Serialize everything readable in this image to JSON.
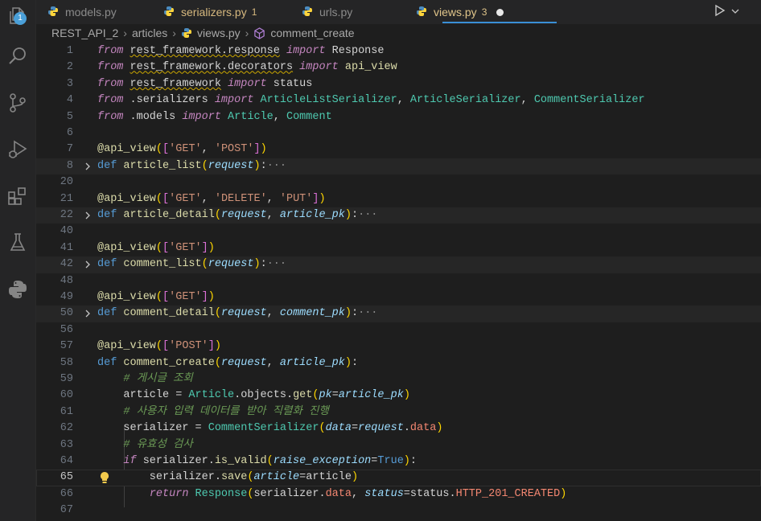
{
  "tabs": [
    {
      "label": "models.py",
      "count": "",
      "state": "normal"
    },
    {
      "label": "serializers.py",
      "count": "1",
      "state": "modified"
    },
    {
      "label": "urls.py",
      "count": "",
      "state": "normal"
    },
    {
      "label": "views.py",
      "count": "3",
      "state": "active"
    }
  ],
  "activity": {
    "scm_badge": "1"
  },
  "breadcrumb": {
    "items": [
      "REST_API_2",
      "articles",
      "views.py",
      "comment_create"
    ]
  },
  "colors": {
    "accent": "#3a8fd6",
    "bulb": "#f2c94c"
  },
  "lines": [
    {
      "n": "1",
      "html": "<span class='ctl'>from</span> <span class='sq'>rest_framework.response</span> <span class='ctl'>import</span> Response"
    },
    {
      "n": "2",
      "html": "<span class='ctl'>from</span> <span class='sq'>rest_framework.decorators</span> <span class='ctl'>import</span> <span class='fn'>api_view</span>"
    },
    {
      "n": "3",
      "html": "<span class='ctl'>from</span> <span class='sq'>rest_framework</span> <span class='ctl'>import</span> status"
    },
    {
      "n": "4",
      "html": "<span class='ctl'>from</span> .serializers <span class='ctl'>import</span> <span class='cls'>ArticleListSerializer</span>, <span class='cls'>ArticleSerializer</span>, <span class='cls'>CommentSerializer</span>"
    },
    {
      "n": "5",
      "html": "<span class='ctl'>from</span> .models <span class='ctl'>import</span> <span class='cls'>Article</span>, <span class='cls'>Comment</span>"
    },
    {
      "n": "6",
      "html": ""
    },
    {
      "n": "7",
      "html": "<span class='dec'>@api_view</span><span class='yb'>(</span><span class='pb'>[</span><span class='str'>'GET'</span>, <span class='str'>'POST'</span><span class='pb'>]</span><span class='yb'>)</span>"
    },
    {
      "n": "8",
      "fold": true,
      "hl": true,
      "html": "<span class='kw'>def</span> <span class='fn'>article_list</span><span class='yb'>(</span><span class='prm'>request</span><span class='yb'>)</span>:<span class='ell'>···</span>"
    },
    {
      "n": "20",
      "html": ""
    },
    {
      "n": "21",
      "html": "<span class='dec'>@api_view</span><span class='yb'>(</span><span class='pb'>[</span><span class='str'>'GET'</span>, <span class='str'>'DELETE'</span>, <span class='str'>'PUT'</span><span class='pb'>]</span><span class='yb'>)</span>"
    },
    {
      "n": "22",
      "fold": true,
      "hl": true,
      "html": "<span class='kw'>def</span> <span class='fn'>article_detail</span><span class='yb'>(</span><span class='prm'>request</span>, <span class='prm'>article_pk</span><span class='yb'>)</span>:<span class='ell'>···</span>"
    },
    {
      "n": "40",
      "html": ""
    },
    {
      "n": "41",
      "html": "<span class='dec'>@api_view</span><span class='yb'>(</span><span class='pb'>[</span><span class='str'>'GET'</span><span class='pb'>]</span><span class='yb'>)</span>"
    },
    {
      "n": "42",
      "fold": true,
      "hl": true,
      "html": "<span class='kw'>def</span> <span class='fn'>comment_list</span><span class='yb'>(</span><span class='prm'>request</span><span class='yb'>)</span>:<span class='ell'>···</span>"
    },
    {
      "n": "48",
      "html": ""
    },
    {
      "n": "49",
      "html": "<span class='dec'>@api_view</span><span class='yb'>(</span><span class='pb'>[</span><span class='str'>'GET'</span><span class='pb'>]</span><span class='yb'>)</span>"
    },
    {
      "n": "50",
      "fold": true,
      "hl": true,
      "html": "<span class='kw'>def</span> <span class='fn'>comment_detail</span><span class='yb'>(</span><span class='prm'>request</span>, <span class='prm'>comment_pk</span><span class='yb'>)</span>:<span class='ell'>···</span>"
    },
    {
      "n": "56",
      "html": ""
    },
    {
      "n": "57",
      "html": "<span class='dec'>@api_view</span><span class='yb'>(</span><span class='pb'>[</span><span class='str'>'POST'</span><span class='pb'>]</span><span class='yb'>)</span>"
    },
    {
      "n": "58",
      "html": "<span class='kw'>def</span> <span class='fn'>comment_create</span><span class='yb'>(</span><span class='prm'>request</span>, <span class='prm'>article_pk</span><span class='yb'>)</span>:"
    },
    {
      "n": "59",
      "html": "    <span class='cmt'># 게시글 조회</span>"
    },
    {
      "n": "60",
      "html": "    article = <span class='cls'>Article</span>.objects.<span class='fn'>get</span><span class='yb'>(</span><span class='prm'>pk</span>=<span class='prm'>article_pk</span><span class='yb'>)</span>"
    },
    {
      "n": "61",
      "html": "    <span class='cmt'># 사용자 입력 데이터를 받아 직렬화 진행</span>"
    },
    {
      "n": "62",
      "html": "    serializer = <span class='cls'>CommentSerializer</span><span class='yb'>(</span><span class='prm'>data</span>=<span class='prm'>request</span>.<span class='attr'>data</span><span class='yb'>)</span>"
    },
    {
      "n": "63",
      "html": "    <span class='cmt'># 유효성 검사</span>"
    },
    {
      "n": "64",
      "html": "    <span class='ctl'>if</span> serializer.<span class='fn'>is_valid</span><span class='yb'>(</span><span class='prm'>raise_exception</span>=<span class='kw'>True</span><span class='yb'>)</span>:"
    },
    {
      "n": "65",
      "cur": true,
      "bulb": true,
      "html": "        serializer.<span class='fn'>save</span><span class='yb'>(</span><span class='prm'>article</span>=article<span class='yb'>)</span>"
    },
    {
      "n": "66",
      "html": "        <span class='ctl'>return</span> <span class='cls'>Response</span><span class='yb'>(</span>serializer.<span class='attr'>data</span>, <span class='prm'>status</span>=status.<span class='attr'>HTTP_201_CREATED</span><span class='yb'>)</span>"
    },
    {
      "n": "67",
      "html": ""
    }
  ]
}
